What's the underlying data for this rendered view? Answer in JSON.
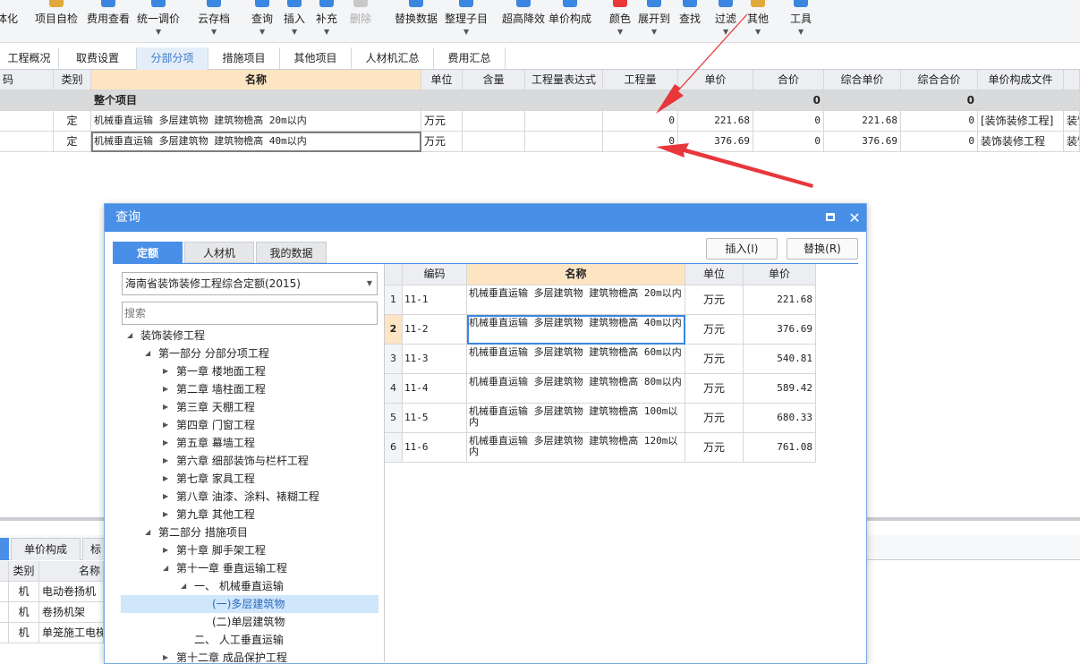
{
  "toolbar": {
    "items": [
      "体化",
      "项目自检",
      "费用查看",
      "统一调价",
      "云存档",
      "查询",
      "插入",
      "补充",
      "删除",
      "替换数据",
      "整理子目",
      "超高降效",
      "单价构成",
      "颜色",
      "展开到",
      "查找",
      "过滤",
      "其他",
      "工具"
    ]
  },
  "tabs": [
    "工程概况",
    "取费设置",
    "分部分项",
    "措施项目",
    "其他项目",
    "人材机汇总",
    "费用汇总"
  ],
  "grid": {
    "headers": [
      "码",
      "类别",
      "名称",
      "单位",
      "含量",
      "工程量表达式",
      "工程量",
      "单价",
      "合价",
      "综合单价",
      "综合合价",
      "单价构成文件"
    ],
    "summary": {
      "name": "整个项目",
      "total": "0",
      "sum_total": "0"
    },
    "rows": [
      {
        "type": "定",
        "name": "机械垂直运输 多层建筑物 建筑物檐高 20m以内",
        "unit": "万元",
        "qty": "0",
        "price": "221.68",
        "total": "0",
        "comp_price": "221.68",
        "comp_total": "0",
        "file": "[装饰装修工程]",
        "extra": "装饰"
      },
      {
        "type": "定",
        "name": "机械垂直运输 多层建筑物 建筑物檐高 40m以内",
        "unit": "万元",
        "qty": "0",
        "price": "376.69",
        "total": "0",
        "comp_price": "376.69",
        "comp_total": "0",
        "file": "装饰装修工程",
        "extra": "装饰"
      }
    ]
  },
  "bottom": {
    "tabs": [
      "单价构成",
      "标"
    ],
    "headers": [
      "类别",
      "名称"
    ],
    "rows": [
      {
        "type": "机",
        "name": "电动卷扬机"
      },
      {
        "type": "机",
        "name": "卷扬机架"
      },
      {
        "type": "机",
        "name": "单笼施工电梯"
      }
    ]
  },
  "dialog": {
    "title": "查询",
    "tabs": [
      "定额",
      "人材机",
      "我的数据"
    ],
    "insert_label": "插入(I)",
    "replace_label": "替换(R)",
    "combo_value": "海南省装饰装修工程综合定额(2015)",
    "search_placeholder": "搜索",
    "tree": [
      "装饰装修工程",
      "第一部分 分部分项工程",
      "第一章 楼地面工程",
      "第二章 墙柱面工程",
      "第三章 天棚工程",
      "第四章 门窗工程",
      "第五章 幕墙工程",
      "第六章 细部装饰与栏杆工程",
      "第七章 家具工程",
      "第八章 油漆、涂料、裱糊工程",
      "第九章 其他工程",
      "第二部分 措施项目",
      "第十章 脚手架工程",
      "第十一章 垂直运输工程",
      "一、 机械垂直运输",
      "(一)多层建筑物",
      "(二)单层建筑物",
      "二、 人工垂直运输",
      "第十二章 成品保护工程"
    ],
    "grid_headers": [
      "编码",
      "名称",
      "单位",
      "单价"
    ],
    "grid_rows": [
      {
        "idx": "1",
        "code": "11-1",
        "name": "机械垂直运输 多层建筑物 建筑物檐高 20m以内",
        "unit": "万元",
        "price": "221.68"
      },
      {
        "idx": "2",
        "code": "11-2",
        "name": "机械垂直运输 多层建筑物 建筑物檐高 40m以内",
        "unit": "万元",
        "price": "376.69"
      },
      {
        "idx": "3",
        "code": "11-3",
        "name": "机械垂直运输 多层建筑物 建筑物檐高 60m以内",
        "unit": "万元",
        "price": "540.81"
      },
      {
        "idx": "4",
        "code": "11-4",
        "name": "机械垂直运输 多层建筑物 建筑物檐高 80m以内",
        "unit": "万元",
        "price": "589.42"
      },
      {
        "idx": "5",
        "code": "11-5",
        "name": "机械垂直运输 多层建筑物 建筑物檐高 100m以内",
        "unit": "万元",
        "price": "680.33"
      },
      {
        "idx": "6",
        "code": "11-6",
        "name": "机械垂直运输 多层建筑物 建筑物檐高 120m以内",
        "unit": "万元",
        "price": "761.08"
      }
    ]
  },
  "colors": {
    "accent": "#4a8fe7",
    "arrow": "#e8373b",
    "header_name": "#fde4c3",
    "summary_row": "#d9dadc"
  }
}
